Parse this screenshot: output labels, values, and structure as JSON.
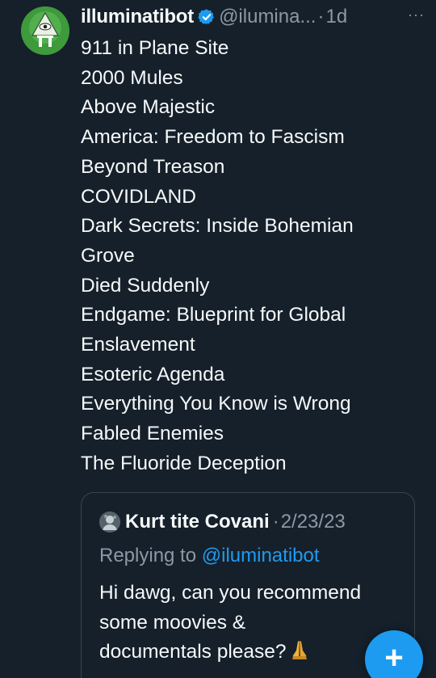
{
  "tweet": {
    "author": {
      "display_name": "illuminatibot",
      "handle": "@ilumina...",
      "verified": true,
      "avatar_icon": "illuminati-eye-pyramid-avatar"
    },
    "separator": "·",
    "time": "1d",
    "more_label": "···",
    "body_lines": [
      "911 in Plane Site",
      "2000 Mules",
      "Above Majestic",
      "America: Freedom to Fascism",
      "Beyond Treason",
      "COVIDLAND",
      "Dark Secrets: Inside Bohemian",
      "Grove",
      "Died Suddenly",
      "Endgame: Blueprint for Global",
      "Enslavement",
      "Esoteric Agenda",
      "Everything You Know is Wrong",
      "Fabled Enemies",
      "The Fluoride Deception"
    ]
  },
  "quoted_tweet": {
    "author": {
      "display_name": "Kurt tite Covani",
      "avatar_icon": "user-avatar"
    },
    "separator": "·",
    "date": "2/23/23",
    "replying_prefix": "Replying to",
    "replying_mention": "@iluminatibot",
    "text_lines": [
      "Hi dawg, can you recommend",
      "some moovies &",
      "documentals please?"
    ],
    "emoji": "folded-hands-emoji"
  },
  "compose_button": {
    "label": "+",
    "icon": "plus-icon"
  },
  "colors": {
    "background": "#15202b",
    "text_primary": "#f7f9f9",
    "text_secondary": "#8b98a5",
    "accent": "#1d9bf0",
    "border": "#38444d"
  }
}
